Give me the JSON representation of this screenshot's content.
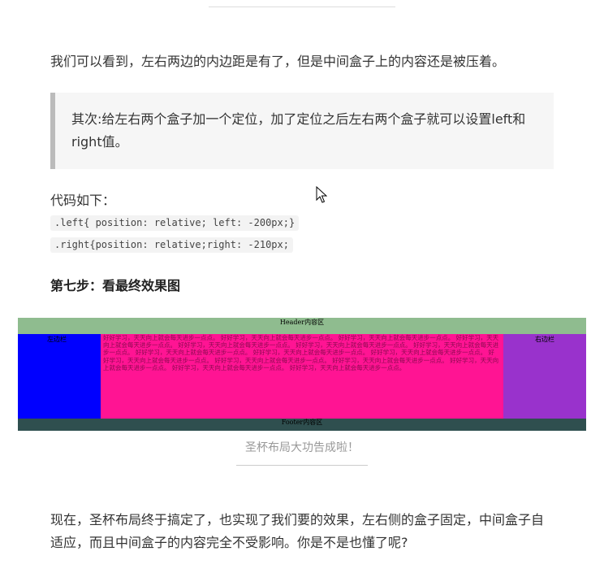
{
  "article": {
    "paragraph_1": "我们可以看到，左右两边的内边距是有了，但是中间盒子上的内容还是被压着。",
    "quote": "其次:给左右两个盒子加一个定位，加了定位之后左右两个盒子就可以设置left和right值。",
    "code_intro": "代码如下：",
    "code_lines": [
      ".left{ position: relative; left: -200px;}",
      ".right{position: relative;right: -210px;"
    ],
    "step_heading": "第七步：看最终效果图",
    "image_caption": "圣杯布局大功告成啦！",
    "closing_paragraph": "现在，圣杯布局终于搞定了，也实现了我们要的效果，左右侧的盒子固定，中间盒子自适应，而且中间盒子的内容完全不受影响。你是不是也懂了呢?"
  },
  "demo_figure": {
    "header_label": "Header内容区",
    "left_label": "左边栏",
    "main_text": "好好学习，天天向上就会每天进步一点点。 好好学习，天天向上就会每天进步一点点。 好好学习，天天向上就会每天进步一点点。 好好学习，天天向上就会每天进步一点点。 好好学习，天天向上就会每天进步一点点。 好好学习，天天向上就会每天进步一点点。 好好学习，天天向上就会每天进步一点点。 好好学习，天天向上就会每天进步一点点。 好好学习，天天向上就会每天进步一点点。 好好学习，天天向上就会每天进步一点点。 好好学习，天天向上就会每天进步一点点。 好好学习，天天向上就会每天进步一点点。 好好学习，天天向上就会每天进步一点点。 好好学习，天天向上就会每天进步一点点。 好好学习，天天向上就会每天进步一点点。 好好学习，天天向上就会每天进步一点点。",
    "right_label": "右边栏",
    "footer_label": "Footer内容区",
    "colors": {
      "header": "#8fbc8f",
      "left": "#0000ff",
      "main": "#ff1493",
      "right": "#9932cc",
      "footer": "#2f4f4f"
    }
  }
}
